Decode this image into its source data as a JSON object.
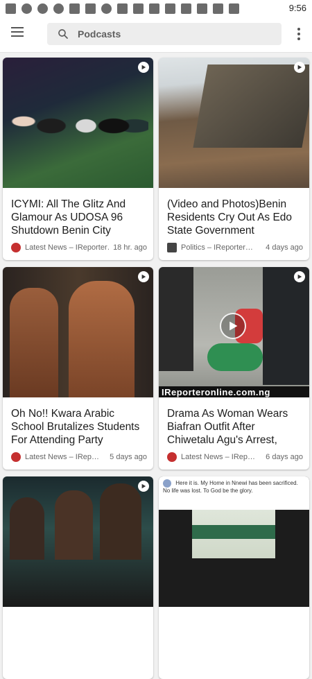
{
  "status_bar": {
    "time": "9:56"
  },
  "search": {
    "placeholder": "Podcasts"
  },
  "cards": [
    {
      "title": "ICYMI: All The Glitz And Glamour As UDOSA 96 Shutdown Benin City",
      "source": "Latest News – IReporter…",
      "time": "18 hr. ago",
      "colors": [
        "#1f2a3a",
        "#3b6b3a",
        "#2b2f3a"
      ]
    },
    {
      "title": "(Video and Photos)Benin Residents Cry Out As Edo State Government",
      "source": "Politics – IReporter…",
      "time": "4 days ago",
      "colors": [
        "#cfd5d8",
        "#6f5a45",
        "#8a6c4f"
      ]
    },
    {
      "title": "Oh No!! Kwara Arabic School Brutalizes Students For Attending Party",
      "source": "Latest News – IRep…",
      "time": "5 days ago",
      "colors": [
        "#3a2a22",
        "#9a5e3c",
        "#6a4a2f"
      ]
    },
    {
      "title": "Drama As Woman Wears Biafran Outfit After Chiwetalu Agu's Arrest,",
      "source": "Latest News – IRep…",
      "time": "6 days ago",
      "watermark": "IReporteronline.com.ng",
      "colors": [
        "#b7b8b2",
        "#2f8f52",
        "#d33c3c"
      ]
    },
    {
      "colors": [
        "#1b2a2e",
        "#2d4d4a",
        "#1a1a1a"
      ]
    },
    {
      "fb_text": "Here it is. My Home in Nnewi has been sacrificed. No life was lost. To God be the glory.",
      "colors": [
        "#ffffff",
        "#1c1c1c",
        "#cfd8c8"
      ]
    }
  ]
}
